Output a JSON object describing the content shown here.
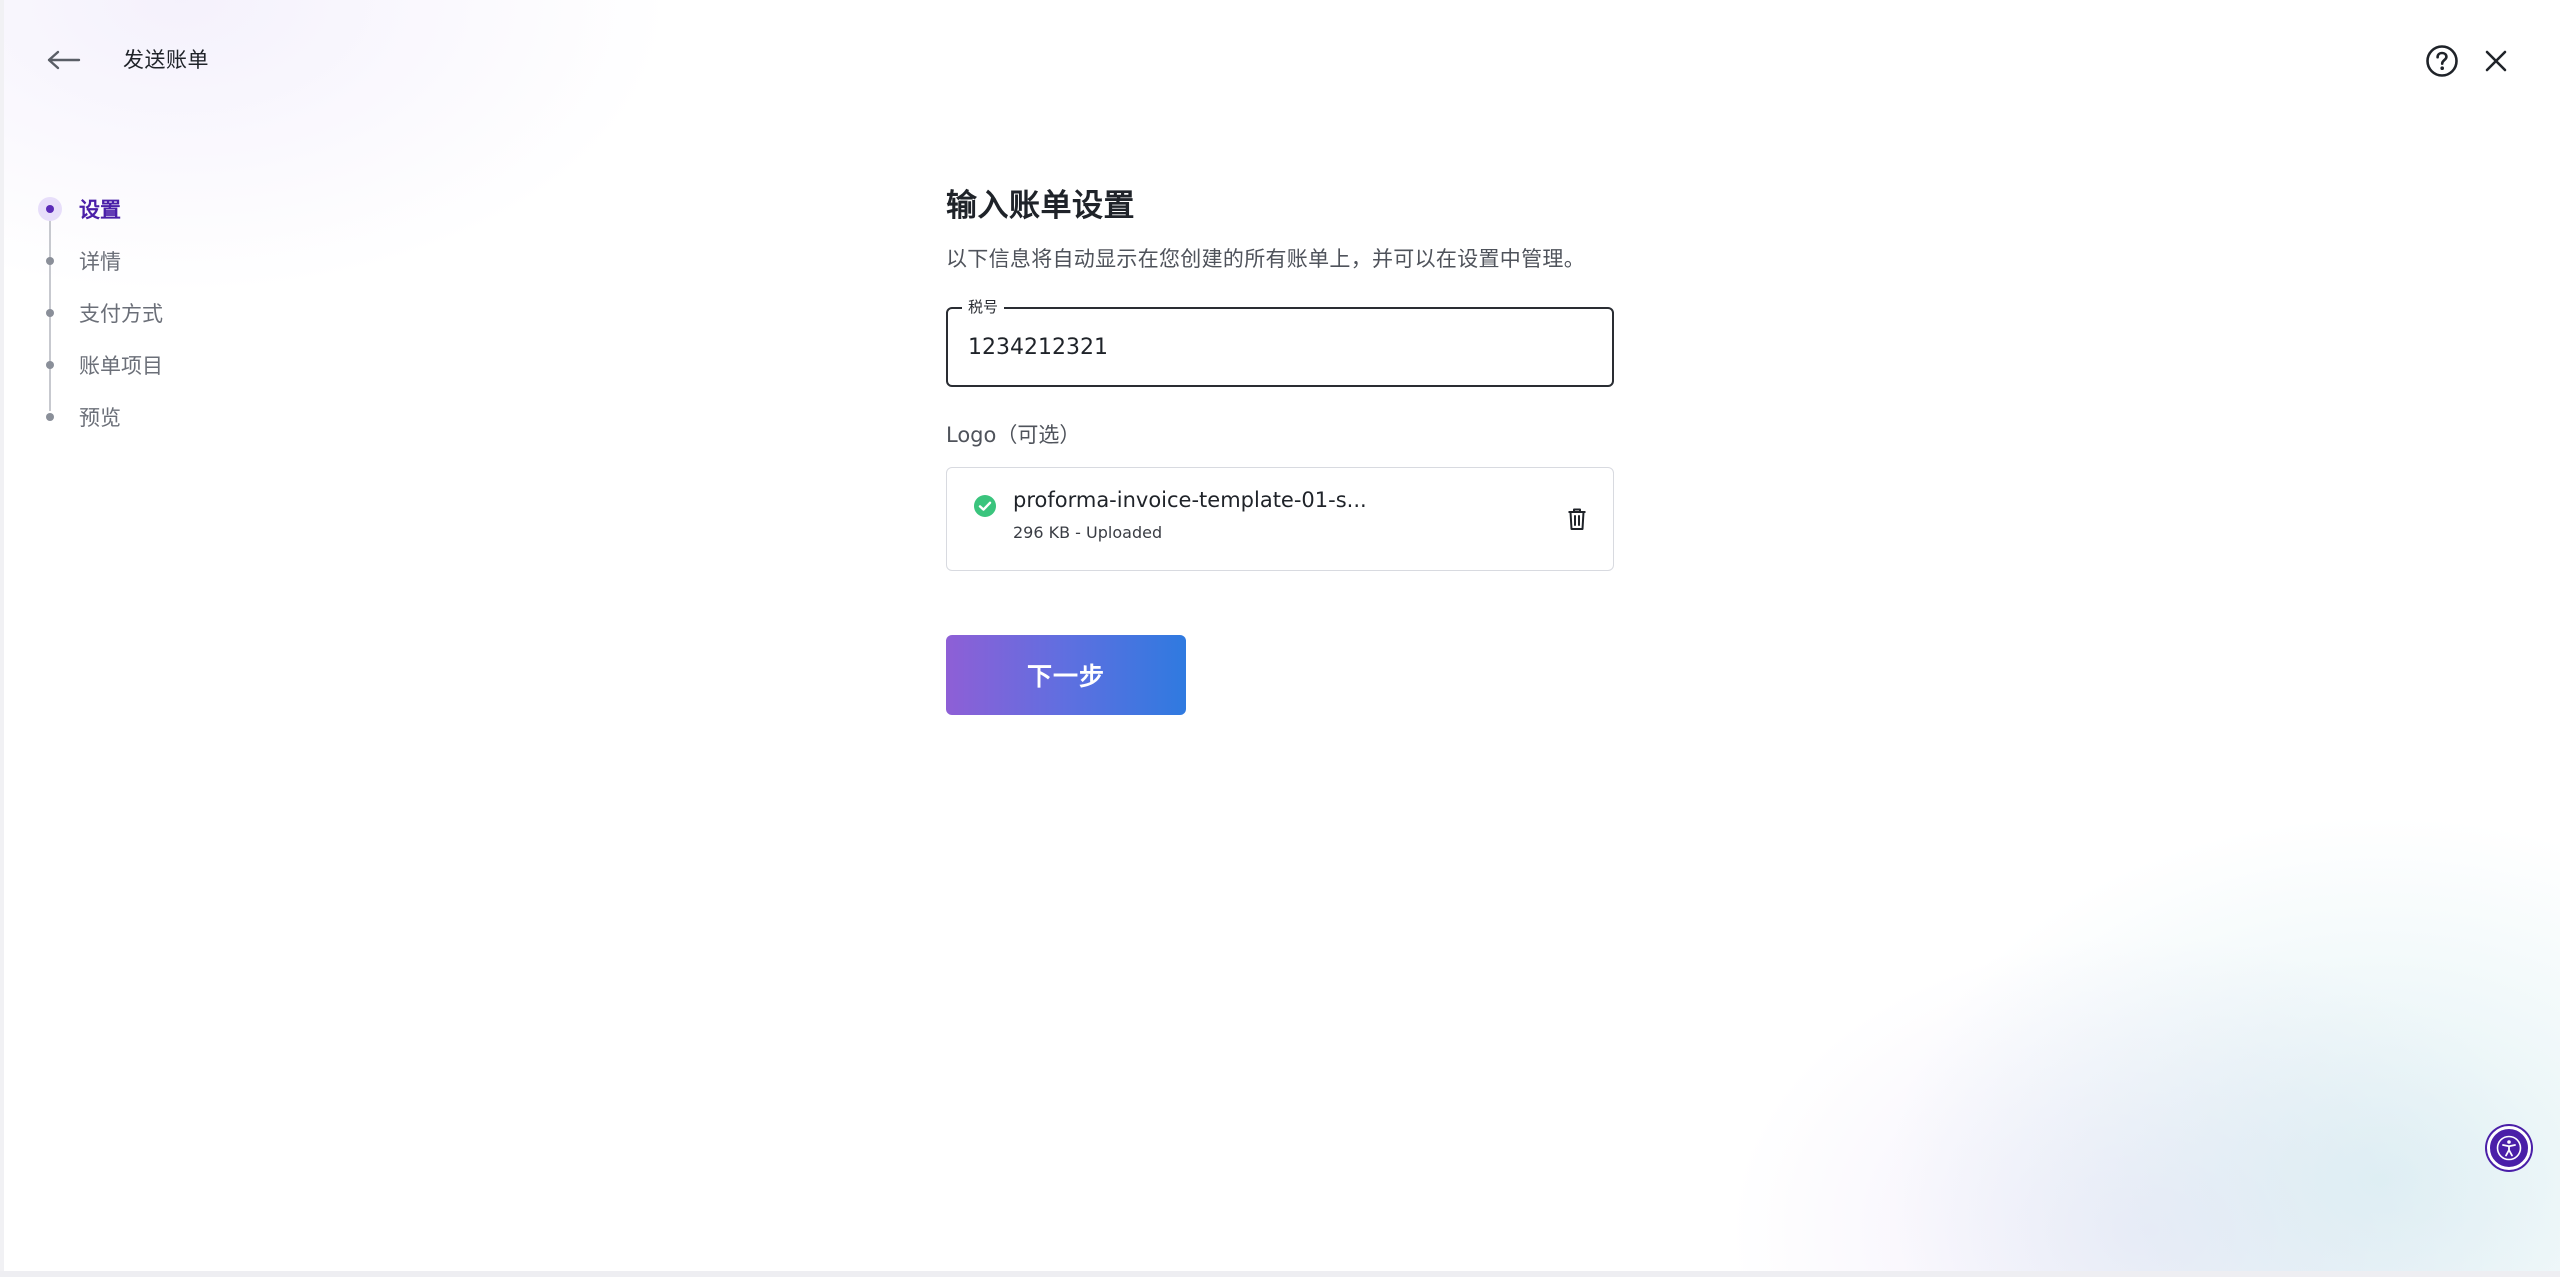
{
  "header": {
    "title": "发送账单",
    "back_icon": "arrow-left-icon",
    "help_icon": "help-circle-icon",
    "close_icon": "close-icon"
  },
  "stepper": {
    "items": [
      {
        "label": "设置",
        "active": true
      },
      {
        "label": "详情",
        "active": false
      },
      {
        "label": "支付方式",
        "active": false
      },
      {
        "label": "账单项目",
        "active": false
      },
      {
        "label": "预览",
        "active": false
      }
    ],
    "active_color": "#4a1fa8"
  },
  "main": {
    "title": "输入账单设置",
    "description": "以下信息将自动显示在您创建的所有账单上，并可以在设置中管理。",
    "tax_field": {
      "label": "税号",
      "value": "1234212321"
    },
    "logo": {
      "label": "Logo（可选）",
      "file_name": "proforma-invoice-template-01-s...",
      "file_meta": "296 KB - Uploaded",
      "status_icon": "check-circle-icon",
      "status_color": "#3ac47d",
      "delete_icon": "trash-icon"
    },
    "next_button": "下一步"
  },
  "accessibility": {
    "icon": "accessibility-icon"
  }
}
